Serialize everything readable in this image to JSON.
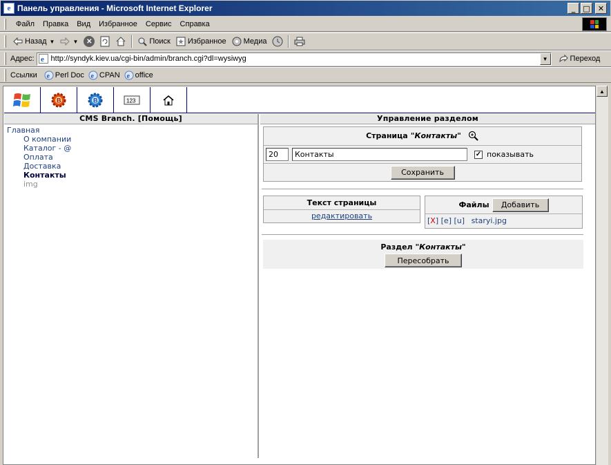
{
  "window": {
    "title": "Панель управления - Microsoft Internet Explorer",
    "controls": {
      "minimize": "_",
      "maximize": "□",
      "close": "✕"
    }
  },
  "menu": [
    "Файл",
    "Правка",
    "Вид",
    "Избранное",
    "Сервис",
    "Справка"
  ],
  "toolbar": {
    "back": "Назад",
    "search": "Поиск",
    "favorites": "Избранное",
    "media": "Медиа"
  },
  "address": {
    "label": "Адрес:",
    "url": "http://syndyk.kiev.ua/cgi-bin/admin/branch.cgi?dl=wysiwyg",
    "go": "Переход"
  },
  "links": {
    "label": "Ссылки",
    "items": [
      "Perl Doc",
      "CPAN",
      "office"
    ]
  },
  "icon_bar": [
    "windows-icon",
    "gear-red-icon",
    "gear-blue-icon",
    "numbers-icon",
    "home-icon"
  ],
  "left_panel": {
    "header": "CMS Branch. [Помощь]",
    "root": "Главная",
    "items": [
      "О компании",
      "Каталог - @",
      "Оплата",
      "Доставка",
      "Контакты",
      "img"
    ]
  },
  "right_panel": {
    "header": "Управление разделом",
    "page_label": "Страница",
    "page_name": "\"Контакты\"",
    "order_value": "20",
    "name_value": "Контакты",
    "show_checked": true,
    "show_label": "показывать",
    "save_button": "Сохранить",
    "text_header": "Текст страницы",
    "edit_link": "редактировать",
    "files_header": "Файлы",
    "add_button": "Добавить",
    "file_actions": [
      "[X]",
      "[e]",
      "[u]"
    ],
    "file_name": "staryi.jpg",
    "section_label": "Раздел",
    "section_name": "\"Контакты\"",
    "rebuild_button": "Пересобрать"
  }
}
